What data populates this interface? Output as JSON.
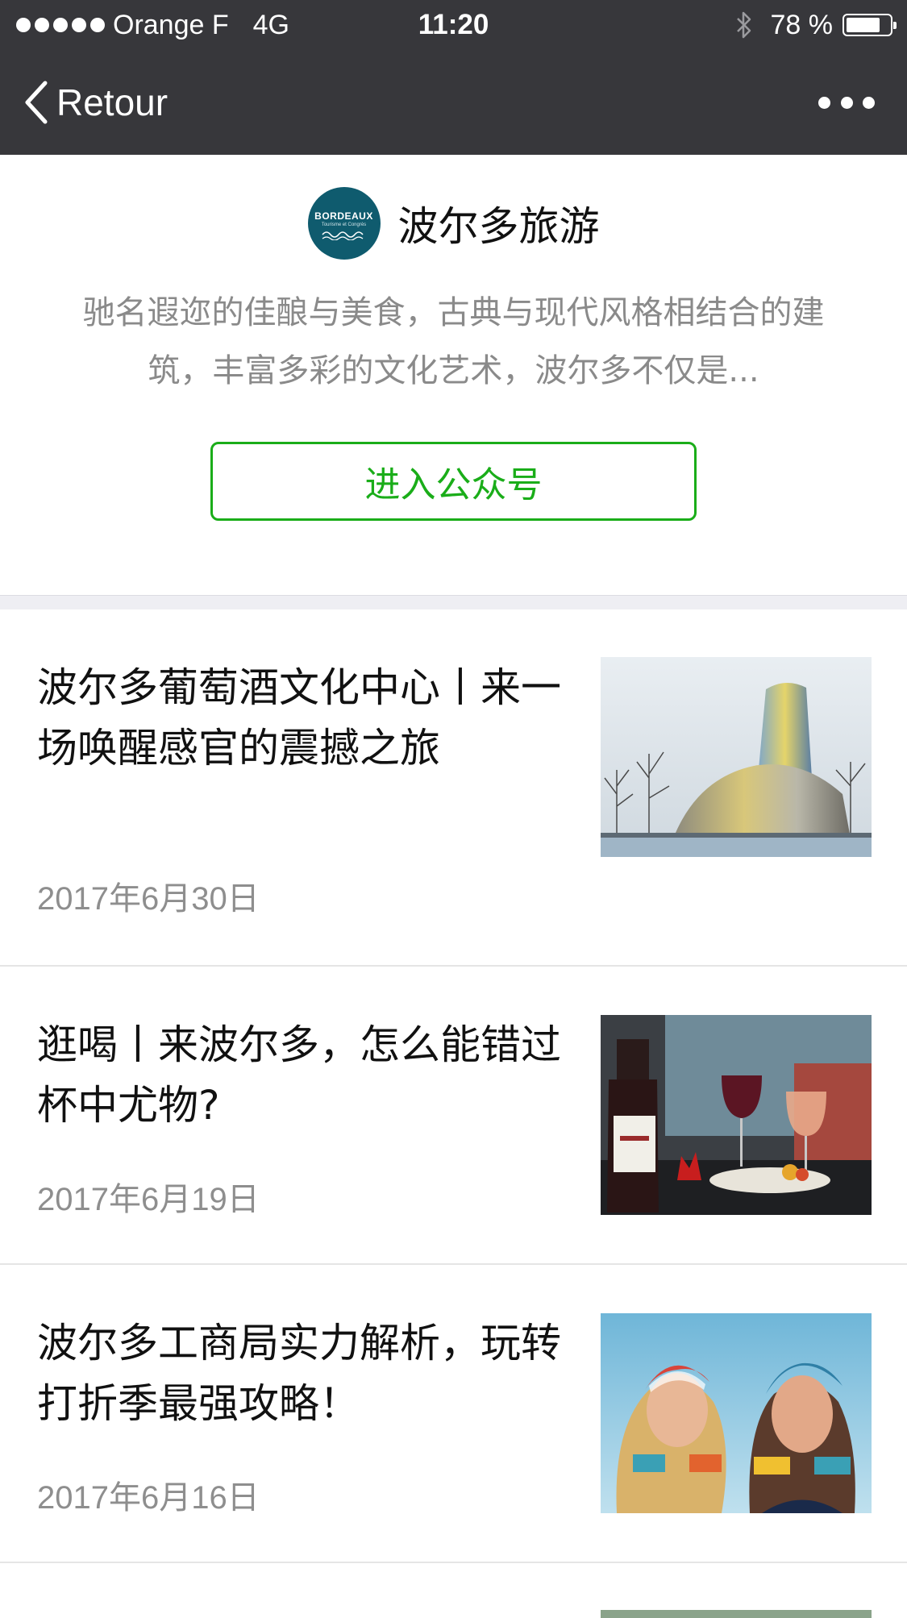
{
  "status_bar": {
    "carrier": "Orange F",
    "network": "4G",
    "time": "11:20",
    "battery_text": "78 %",
    "battery_level": 0.78,
    "icons": [
      "signal-icon",
      "bluetooth-icon",
      "battery-icon"
    ]
  },
  "nav": {
    "back_label": "Retour",
    "icons": [
      "chevron-left-icon",
      "more-icon"
    ]
  },
  "profile": {
    "avatar_text": "BORDEAUX",
    "avatar_subtext": "Tourisme et Congrès",
    "avatar_color": "#0f5b6e",
    "name": "波尔多旅游",
    "description": "驰名遐迩的佳酿与美食，古典与现代风格相结合的建筑，丰富多彩的文化艺术，波尔多不仅是...",
    "enter_button": "进入公众号",
    "accent_color": "#1aad19"
  },
  "articles": [
    {
      "title": "波尔多葡萄酒文化中心丨来一场唤醒感官的震撼之旅",
      "date": "2017年6月30日",
      "thumbnail": "wine-culture-center-image"
    },
    {
      "title": "逛喝丨来波尔多，怎么能错过杯中尤物?",
      "date": "2017年6月19日",
      "thumbnail": "wine-glasses-table-image"
    },
    {
      "title": "波尔多工商局实力解析，玩转打折季最强攻略！",
      "date": "2017年6月16日",
      "thumbnail": "fashion-models-image"
    }
  ]
}
